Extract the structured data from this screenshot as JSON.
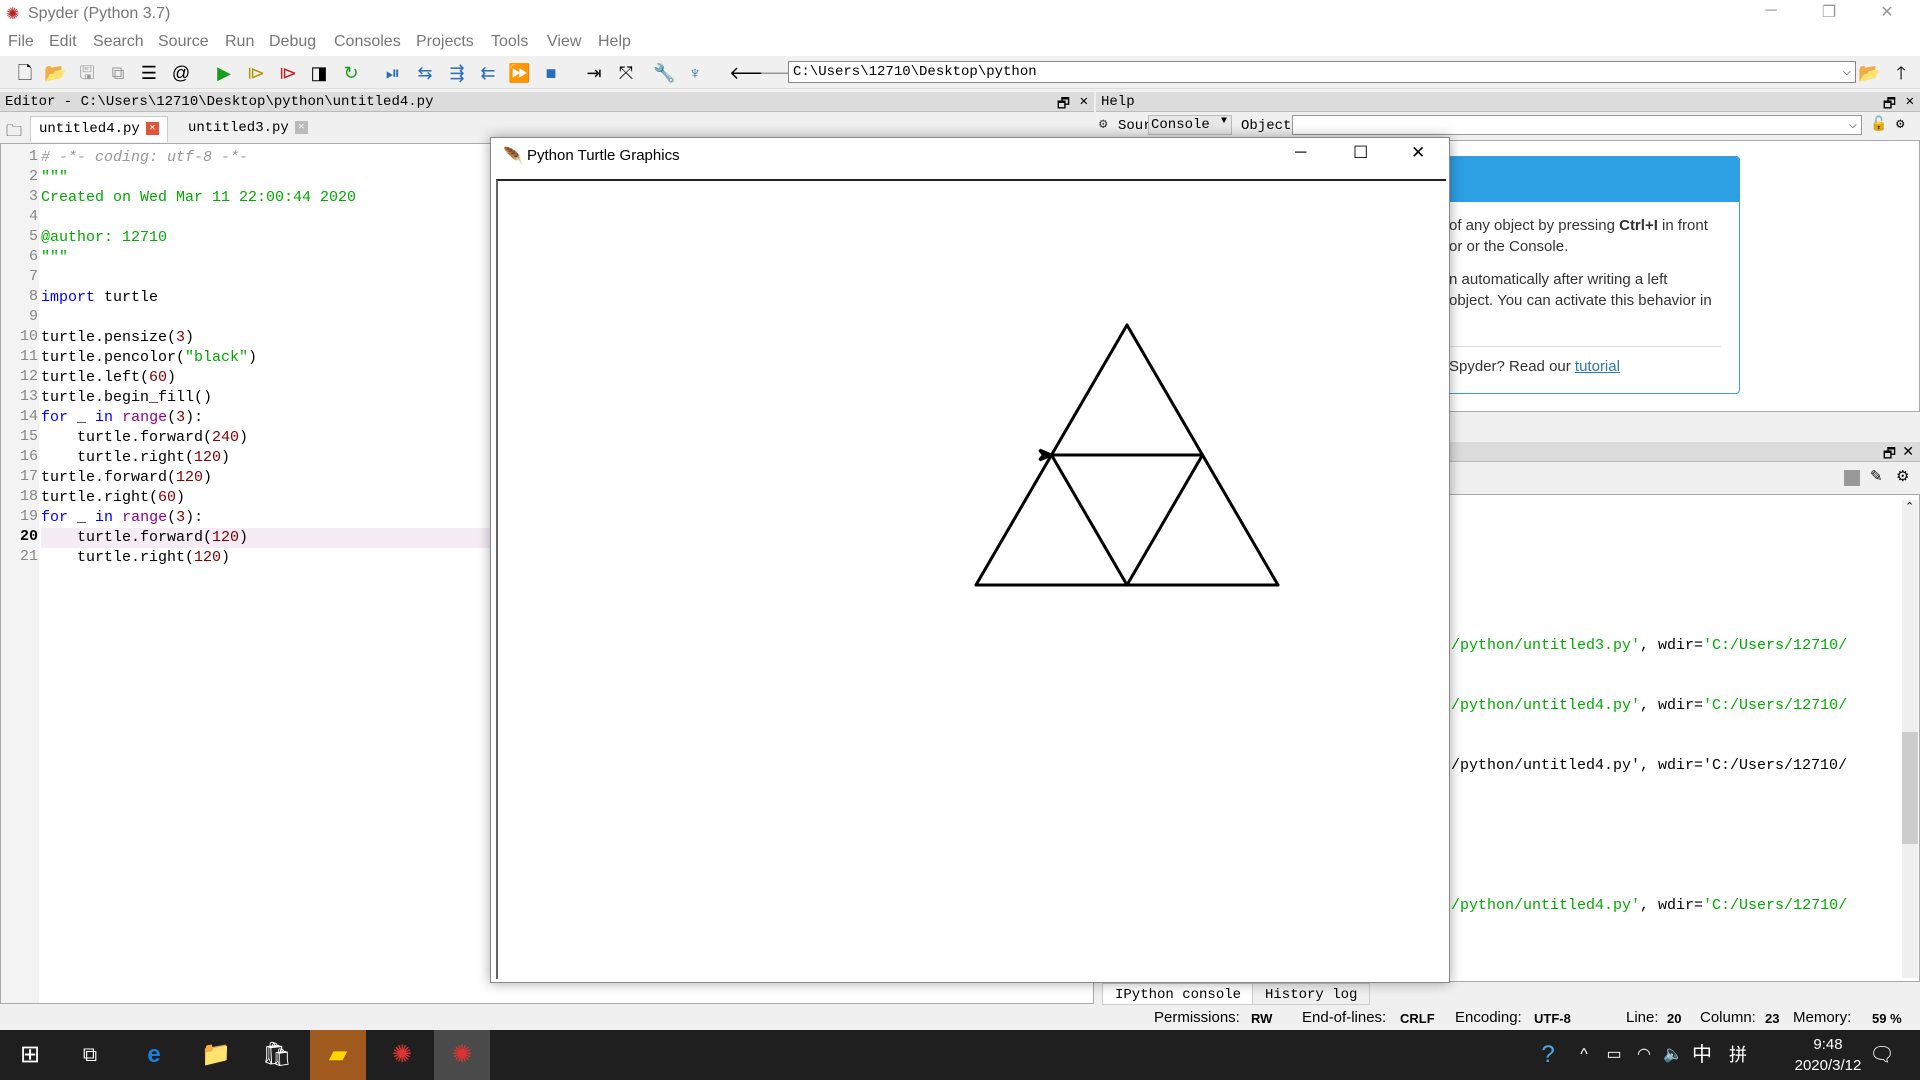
{
  "window": {
    "title": "Spyder (Python 3.7)"
  },
  "menu": [
    "File",
    "Edit",
    "Search",
    "Source",
    "Run",
    "Debug",
    "Consoles",
    "Projects",
    "Tools",
    "View",
    "Help"
  ],
  "toolbar": {
    "path": "C:\\Users\\12710\\Desktop\\python"
  },
  "editor": {
    "header": "Editor - C:\\Users\\12710\\Desktop\\python\\untitled4.py",
    "tabs": [
      {
        "label": "untitled4.py",
        "active": true
      },
      {
        "label": "untitled3.py",
        "active": false
      }
    ],
    "current_line": 20,
    "lines": [
      [
        [
          "# -*- coding: utf-8 -*-",
          "cm"
        ]
      ],
      [
        [
          "\"\"\"",
          "st"
        ]
      ],
      [
        [
          "Created on Wed Mar 11 22:00:44 2020",
          "st"
        ]
      ],
      [],
      [
        [
          "@author: 12710",
          "st"
        ]
      ],
      [
        [
          "\"\"\"",
          "st"
        ]
      ],
      [],
      [
        [
          "import",
          "kw"
        ],
        [
          " turtle",
          ""
        ]
      ],
      [],
      [
        [
          "turtle.pensize(",
          ""
        ],
        [
          "3",
          "nu"
        ],
        [
          ")",
          ""
        ]
      ],
      [
        [
          "turtle.pencolor(",
          ""
        ],
        [
          "\"black\"",
          "st"
        ],
        [
          ")",
          ""
        ]
      ],
      [
        [
          "turtle.left(",
          ""
        ],
        [
          "60",
          "nu"
        ],
        [
          ")",
          ""
        ]
      ],
      [
        [
          "turtle.begin_fill()",
          ""
        ]
      ],
      [
        [
          "for",
          "kw"
        ],
        [
          " _ ",
          ""
        ],
        [
          "in",
          "kw"
        ],
        [
          " ",
          ""
        ],
        [
          "range",
          "bi"
        ],
        [
          "(",
          ""
        ],
        [
          "3",
          "nu"
        ],
        [
          "):",
          ""
        ]
      ],
      [
        [
          "    turtle.forward(",
          ""
        ],
        [
          "240",
          "nu"
        ],
        [
          ")",
          ""
        ]
      ],
      [
        [
          "    turtle.right(",
          ""
        ],
        [
          "120",
          "nu"
        ],
        [
          ")",
          ""
        ]
      ],
      [
        [
          "turtle.forward(",
          ""
        ],
        [
          "120",
          "nu"
        ],
        [
          ")",
          ""
        ]
      ],
      [
        [
          "turtle.right(",
          ""
        ],
        [
          "60",
          "nu"
        ],
        [
          ")",
          ""
        ]
      ],
      [
        [
          "for",
          "kw"
        ],
        [
          " _ ",
          ""
        ],
        [
          "in",
          "kw"
        ],
        [
          " ",
          ""
        ],
        [
          "range",
          "bi"
        ],
        [
          "(",
          ""
        ],
        [
          "3",
          "nu"
        ],
        [
          "):",
          ""
        ]
      ],
      [
        [
          "    turtle.forward(",
          ""
        ],
        [
          "120",
          "nu"
        ],
        [
          ")",
          ""
        ]
      ],
      [
        [
          "    turtle.right(",
          ""
        ],
        [
          "120",
          "nu"
        ],
        [
          ")",
          ""
        ]
      ]
    ]
  },
  "turtle_window": {
    "title": "Python Turtle Graphics",
    "pen_color": "#000000",
    "pen_size": 3
  },
  "help": {
    "header": "Help",
    "source_label": "Source",
    "source_value": "Console",
    "object_label": "Object",
    "accent": "#2d9fe3",
    "lines": [
      "of any object by pressing ",
      "Ctrl+I",
      " in front",
      "or or the Console.",
      "n automatically after writing a left",
      "object. You can activate this behavior in",
      "Spyder? Read our ",
      "tutorial"
    ]
  },
  "console": {
    "lines": [
      [
        [
          "/python/untitled3.py'",
          "st"
        ],
        [
          ", wdir=",
          ""
        ],
        [
          "'C:/Users/12710/",
          "st"
        ]
      ],
      [
        [
          "/python/untitled4.py'",
          "st"
        ],
        [
          ", wdir=",
          ""
        ],
        [
          "'C:/Users/12710/",
          "st"
        ]
      ],
      [
        [
          "/python/untitled4.py', wdir='C:/Users/12710/",
          ""
        ]
      ],
      [
        [
          "/python/untitled4.py'",
          "st"
        ],
        [
          ", wdir=",
          ""
        ],
        [
          "'C:/Users/12710/",
          "st"
        ]
      ]
    ],
    "tabs": [
      "IPython console",
      "History log"
    ]
  },
  "status": {
    "permissions_label": "Permissions:",
    "permissions": "RW",
    "eol_label": "End-of-lines:",
    "eol": "CRLF",
    "encoding_label": "Encoding:",
    "encoding": "UTF-8",
    "line_label": "Line:",
    "line": "20",
    "column_label": "Column:",
    "column": "23",
    "memory_label": "Memory:",
    "memory": "59 %"
  },
  "taskbar": {
    "time": "9:48",
    "date": "2020/3/12",
    "ime1": "中",
    "ime2": "拼"
  }
}
